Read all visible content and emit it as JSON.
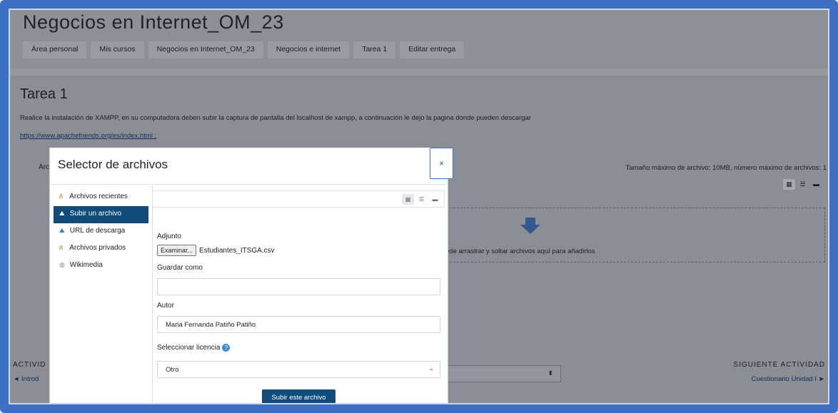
{
  "page": {
    "title": "Negocios en Internet_OM_23",
    "breadcrumb": [
      "Área personal",
      "Mis cursos",
      "Negocios en Internet_OM_23",
      "Negocios e internet",
      "Tarea 1",
      "Editar entrega"
    ],
    "section_title": "Tarea 1",
    "description": "Realice la instalación de XAMPP, en su computadora deben subir la captura de pantalla del localhost de xampp, a continuación le dejo la pagina donde pueden descargar",
    "link": "https://www.apachefriends.org/es/index.html ;",
    "files_label_partial": "Arc",
    "size_info": "Tamaño máximo de archivo: 10MB, número máximo de archivos: 1",
    "drop_text": "ede arrastrar y soltar archivos aquí para añadirlos",
    "prev_activity_title": "ACTIVID",
    "prev_activity_link": "◄ Introd",
    "activity_select_chevron": "⬍",
    "next_activity_title": "SIGUIENTE ACTIVIDAD",
    "next_activity_link": "Cuestionario Unidad I ►"
  },
  "modal": {
    "title": "Selector de archivos",
    "close_symbol": "×",
    "sidebar": [
      {
        "label": "Archivos recientes",
        "icon": "recent-files-icon",
        "glyph": "⫚",
        "active": false
      },
      {
        "label": "Subir un archivo",
        "icon": "upload-icon",
        "glyph": "⛰",
        "active": true
      },
      {
        "label": "URL de descarga",
        "icon": "url-download-icon",
        "glyph": "⛰",
        "active": false
      },
      {
        "label": "Archivos privados",
        "icon": "private-files-icon",
        "glyph": "⫚",
        "active": false
      },
      {
        "label": "Wikimedia",
        "icon": "wikimedia-icon",
        "glyph": "◍",
        "active": false
      }
    ],
    "view_icons": [
      "▦",
      "☰",
      "▬"
    ],
    "attachment_label": "Adjunto",
    "browse_label": "Examinar...",
    "file_name": "Estudiantes_ITSGA.csv",
    "save_as_label": "Guardar como",
    "save_as_value": "",
    "author_label": "Autor",
    "author_value": "Maria Fernanda Patiño Patiño",
    "license_label": "Seleccionar licencia",
    "help_symbol": "?",
    "license_value": "Otro",
    "select_chevron": "⌄",
    "submit_label": "Subir este archivo"
  },
  "colors": {
    "frame": "#3d6fc4",
    "primary": "#0f4c7c",
    "overlay": "#8b8f95"
  }
}
